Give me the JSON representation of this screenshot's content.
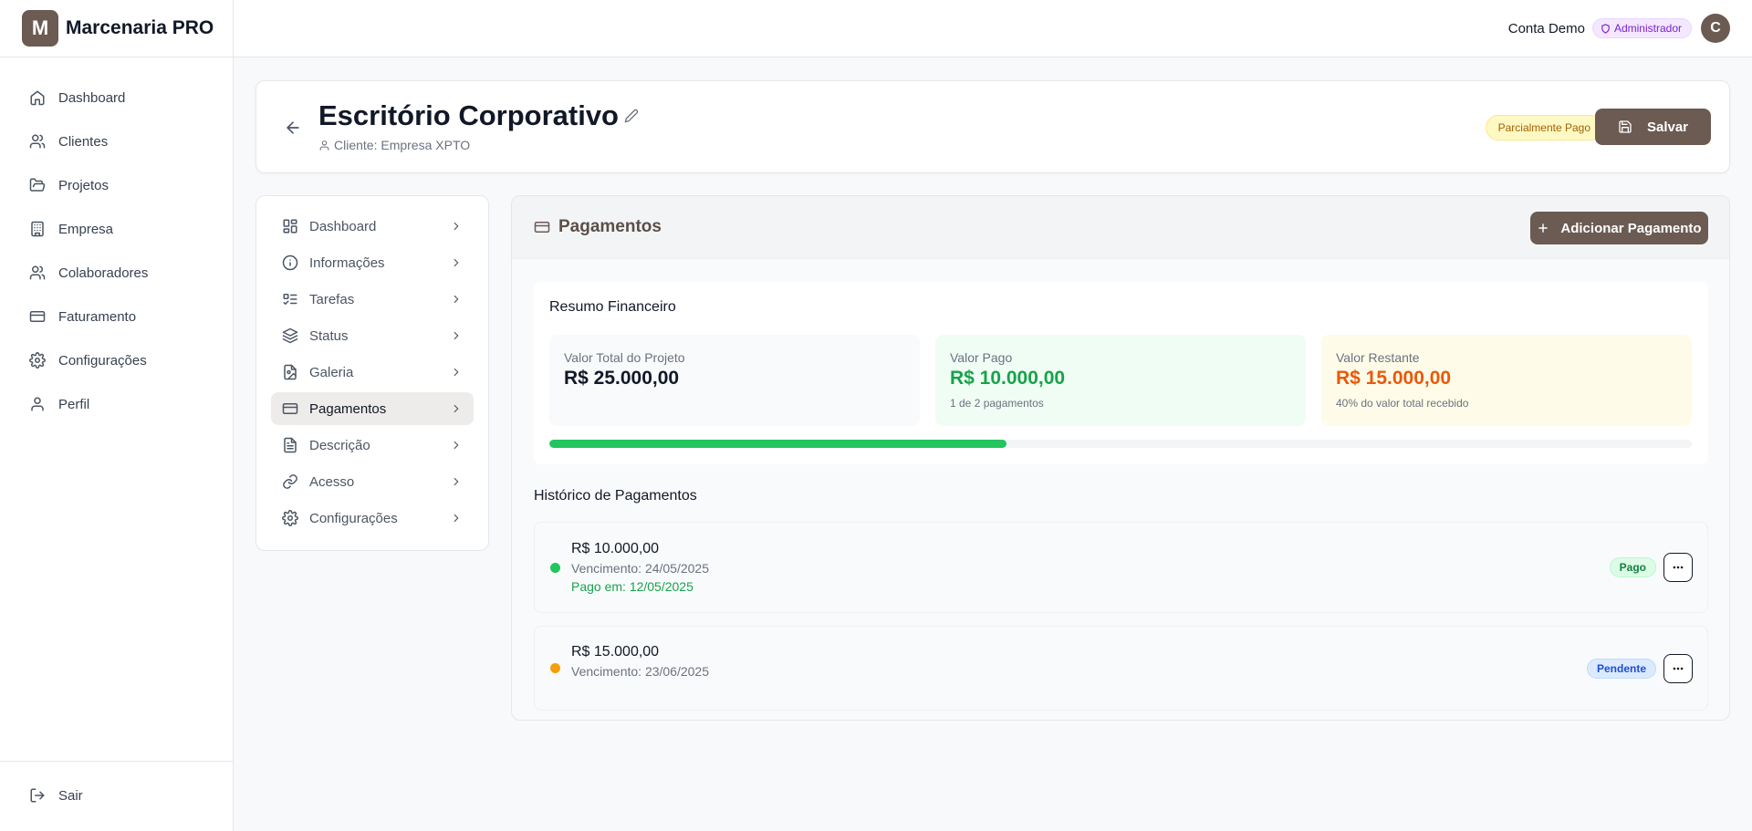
{
  "app": {
    "logo_letter": "M",
    "name": "Marcenaria PRO"
  },
  "sidebar": {
    "items": [
      {
        "label": "Dashboard",
        "icon": "home-icon"
      },
      {
        "label": "Clientes",
        "icon": "users-icon"
      },
      {
        "label": "Projetos",
        "icon": "folder-open-icon"
      },
      {
        "label": "Empresa",
        "icon": "building-icon"
      },
      {
        "label": "Colaboradores",
        "icon": "users-icon"
      },
      {
        "label": "Faturamento",
        "icon": "credit-card-icon"
      },
      {
        "label": "Configurações",
        "icon": "gear-icon"
      },
      {
        "label": "Perfil",
        "icon": "user-icon"
      }
    ],
    "logout_label": "Sair"
  },
  "topbar": {
    "user_name": "Conta Demo",
    "role": "Administrador",
    "avatar_letter": "C"
  },
  "project": {
    "title": "Escritório Corporativo",
    "client": "Cliente: Empresa XPTO",
    "status": "Parcialmente Pago",
    "save_label": "Salvar"
  },
  "subnav": {
    "active_index": 5,
    "items": [
      {
        "label": "Dashboard",
        "icon": "layout-grid-icon"
      },
      {
        "label": "Informações",
        "icon": "info-icon"
      },
      {
        "label": "Tarefas",
        "icon": "list-checks-icon"
      },
      {
        "label": "Status",
        "icon": "layers-icon"
      },
      {
        "label": "Galeria",
        "icon": "file-image-icon"
      },
      {
        "label": "Pagamentos",
        "icon": "credit-card-icon"
      },
      {
        "label": "Descrição",
        "icon": "file-text-icon"
      },
      {
        "label": "Acesso",
        "icon": "link-icon"
      },
      {
        "label": "Configurações",
        "icon": "gear-icon"
      }
    ]
  },
  "payments": {
    "title": "Pagamentos",
    "add_label": "Adicionar Pagamento",
    "summary": {
      "title": "Resumo Financeiro",
      "total_label": "Valor Total do Projeto",
      "total_value": "R$ 25.000,00",
      "paid_label": "Valor Pago",
      "paid_value": "R$ 10.000,00",
      "paid_sub": "1 de 2 pagamentos",
      "remaining_label": "Valor Restante",
      "remaining_value": "R$ 15.000,00",
      "remaining_sub": "40% do valor total recebido",
      "progress_fraction": 0.4
    },
    "history_title": "Histórico de Pagamentos",
    "history": [
      {
        "amount": "R$ 10.000,00",
        "due": "Vencimento: 24/05/2025",
        "paid_on": "Pago em: 12/05/2025",
        "status": "Pago",
        "dot_color": "#22c55e"
      },
      {
        "amount": "R$ 15.000,00",
        "due": "Vencimento: 23/06/2025",
        "paid_on": "",
        "status": "Pendente",
        "dot_color": "#f59e0b"
      }
    ]
  },
  "colors": {
    "brand": "#6b5b52",
    "success": "#22c55e",
    "warning": "#f59e0b"
  }
}
